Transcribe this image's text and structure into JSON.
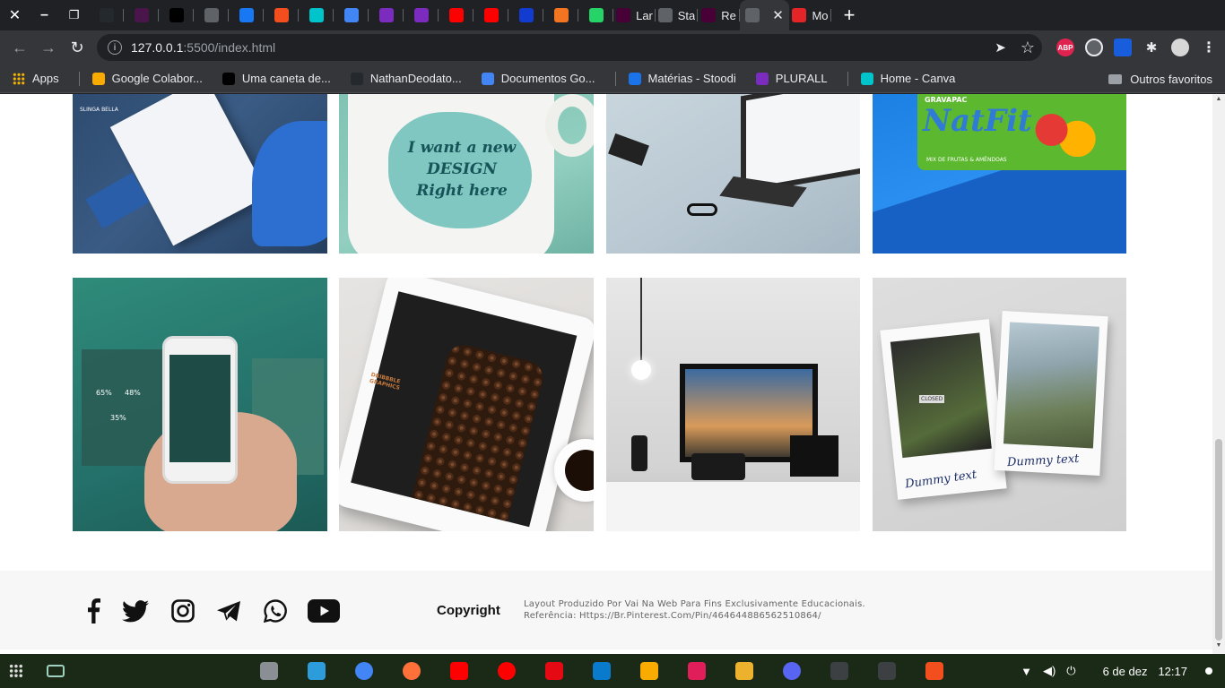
{
  "tabs": [
    {
      "label": "",
      "icon": "github-icon",
      "color": "#24292e"
    },
    {
      "label": "",
      "icon": "slack-icon",
      "color": "#4a154b"
    },
    {
      "label": "",
      "icon": "codepen-icon",
      "color": "#000000"
    },
    {
      "label": "",
      "icon": "globe-icon",
      "color": "#5f6368"
    },
    {
      "label": "",
      "icon": "messenger-icon",
      "color": "#1877f2"
    },
    {
      "label": "",
      "icon": "figma-icon",
      "color": "#f24e1e"
    },
    {
      "label": "",
      "icon": "canva-icon",
      "color": "#00c4cc"
    },
    {
      "label": "",
      "icon": "docs-icon",
      "color": "#4285f4"
    },
    {
      "label": "",
      "icon": "plurall-icon",
      "color": "#7b2cbf"
    },
    {
      "label": "",
      "icon": "plurall-icon",
      "color": "#7b2cbf"
    },
    {
      "label": "",
      "icon": "youtube-music-icon",
      "color": "#ff0000"
    },
    {
      "label": "",
      "icon": "youtube-icon",
      "color": "#ff0000"
    },
    {
      "label": "",
      "icon": "disney-icon",
      "color": "#113ccf"
    },
    {
      "label": "",
      "icon": "crunchyroll-icon",
      "color": "#f47521"
    },
    {
      "label": "",
      "icon": "whatsapp-icon",
      "color": "#25d366"
    },
    {
      "label": "Lar",
      "icon": "adobe-xd-icon",
      "color": "#470137"
    },
    {
      "label": "Sta",
      "icon": "globe-icon",
      "color": "#5f6368"
    },
    {
      "label": "Re",
      "icon": "adobe-xd-icon",
      "color": "#470137"
    },
    {
      "label": "",
      "icon": "globe-icon",
      "color": "#5f6368",
      "active": true
    },
    {
      "label": "Mo",
      "icon": "zoho-icon",
      "color": "#e42527"
    }
  ],
  "window": {
    "close": "✕",
    "minimize": "–",
    "restore": "❐",
    "new_tab": "+",
    "tab_close": "✕"
  },
  "toolbar": {
    "back": "←",
    "forward": "→",
    "reload": "↻",
    "url_host": "127.0.0.1",
    "url_path": ":5500/index.html",
    "share": "➤",
    "star": "☆",
    "menu": "⋮",
    "extensions": [
      "ABP",
      "",
      "",
      "",
      ""
    ]
  },
  "bookmarks": {
    "items": [
      {
        "label": "Apps",
        "icon": "apps-grid-icon",
        "color": "#f4b400"
      },
      {
        "label": "Google Colabor...",
        "icon": "colab-icon",
        "color": "#f9ab00"
      },
      {
        "label": "Uma caneta de...",
        "icon": "codepen-icon",
        "color": "#000000"
      },
      {
        "label": "NathanDeodato...",
        "icon": "github-icon",
        "color": "#24292e"
      },
      {
        "label": "Documentos Go...",
        "icon": "docs-icon",
        "color": "#4285f4"
      },
      {
        "label": "Matérias - Stoodi",
        "icon": "stoodi-icon",
        "color": "#1a73e8"
      },
      {
        "label": "PLURALL",
        "icon": "plurall-icon",
        "color": "#7b2cbf"
      },
      {
        "label": "Home - Canva",
        "icon": "canva-icon",
        "color": "#00c4cc"
      }
    ],
    "other": "Outros favoritos"
  },
  "gallery": {
    "row1": [
      "SLINGA BELLA",
      "I want a new DESIGN Right here",
      "",
      "NatFit"
    ],
    "row2": [
      "",
      "DRIBBBLE GRAPHICS",
      "",
      "Dummy text"
    ],
    "tile4_sub": "MIX DE FRUTAS & AMÊNDOAS",
    "tile4_brand": "GRAVAPAC",
    "tile8_second": "Dummy text",
    "tile8_sign": "CLOSED",
    "tile5_stats": [
      "65%",
      "48%",
      "35%"
    ]
  },
  "footer": {
    "social": [
      "facebook-icon",
      "twitter-icon",
      "instagram-icon",
      "telegram-icon",
      "whatsapp-icon",
      "youtube-icon"
    ],
    "copyright": "Copyright",
    "line1": "Layout Produzido Por Vai Na Web Para Fins Exclusivamente Educacionais.",
    "line2": "Referência: Https://Br.Pinterest.Com/Pin/464644886562510864/"
  },
  "shelf": {
    "date": "6 de dez",
    "time": "12:17",
    "apps": [
      "files-icon",
      "store-icon",
      "chrome-icon",
      "firefox-icon",
      "youtube-icon",
      "youtube-music-icon",
      "netflix-icon",
      "vscode-icon",
      "keep-icon",
      "slack-icon",
      "hashtag-icon",
      "discord-icon",
      "terminal-icon",
      "terminal-icon",
      "figma-icon"
    ]
  },
  "colors": {
    "chrome_dark": "#202124",
    "chrome_toolbar": "#35363a",
    "page_bg": "#ffffff",
    "footer_bg": "#f7f7f7",
    "shelf_bg": "#1b2a17"
  }
}
